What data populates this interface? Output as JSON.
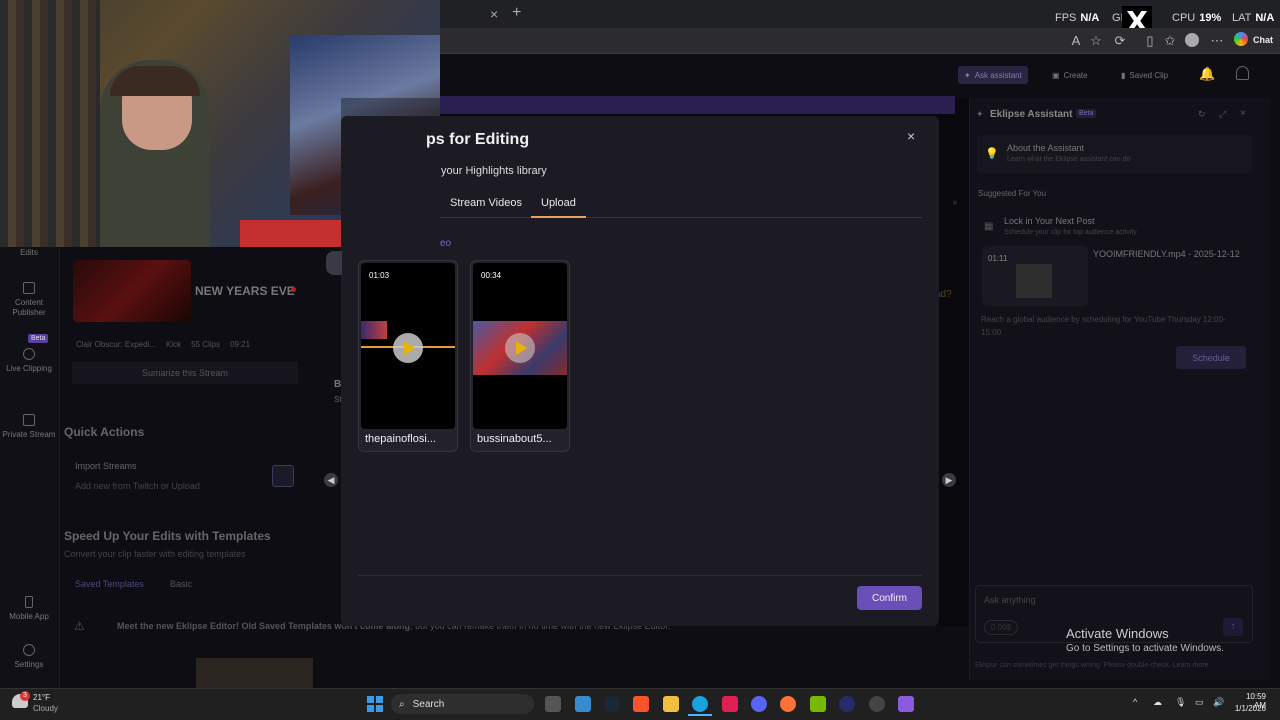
{
  "browser": {
    "new_tab": "+",
    "close_tab": "×",
    "fps_label": "FPS",
    "fps_value": "N/A",
    "gpu_label": "GI",
    "cpu_label": "CPU",
    "cpu_value": "19%",
    "lat_label": "LAT",
    "lat_value": "N/A",
    "chat_label": "Chat"
  },
  "app_header": {
    "ask_assistant": "Ask assistant",
    "create": "Create",
    "saved_clip": "Saved Clip"
  },
  "sidebar": {
    "items": [
      {
        "label": "Edits"
      },
      {
        "label": "Content Publisher"
      },
      {
        "label": "Live Clipping",
        "badge": "Beta"
      },
      {
        "label": "Private Stream"
      },
      {
        "label": "Mobile App"
      },
      {
        "label": "Settings"
      }
    ]
  },
  "main": {
    "stream_title": "NEW YEARS EVE",
    "stream_game": "Clair Obscur: Expedi...",
    "platform": "Kick",
    "clip_count": "55 Clips",
    "time": "09:21",
    "summarize": "Sumarize this Stream",
    "quick_actions": "Quick Actions",
    "import_streams": "Import Streams",
    "import_sub": "Add new from Twitch or Upload",
    "templates_title": "Speed Up Your Edits with Templates",
    "templates_sub": "Convert your clip faster with editing templates",
    "tab_saved": "Saved Templates",
    "tab_basic": "Basic",
    "notice_bold": "Meet the new Eklipse Editor!",
    "notice_bold2": "Old Saved Templates won't come along",
    "notice_rest": ", but you can remake them in no time with the new Eklipse Editor.",
    "partial_d": "ad?",
    "partial_b": "B",
    "partial_st": "St"
  },
  "modal": {
    "title": "ps for Editing",
    "subtitle": "your Highlights library",
    "tabs": [
      "Stream Videos",
      "Upload"
    ],
    "active_tab": "Upload",
    "partial_link": "eo",
    "close": "×",
    "confirm": "Confirm",
    "clips": [
      {
        "duration": "01:03",
        "name": "thepainoflosi..."
      },
      {
        "duration": "00:34",
        "name": "bussinabout5..."
      }
    ]
  },
  "assistant": {
    "title": "Eklipse Assistant",
    "badge": "Beta",
    "about_title": "About the Assistant",
    "about_sub": "Learn what the Eklipse assistant can do",
    "suggested": "Suggested For You",
    "card_title": "Lock in Your Next Post",
    "card_sub": "Schedule your clip for top audience activity",
    "clip_duration": "01:11",
    "clip_name": "YOOIMFRIENDLY.mp4 - 2025-12-12",
    "reach_text": "Reach a global audience by scheduling for YouTube Thursday 12:00-15:00",
    "schedule": "Schedule",
    "ask_placeholder": "Ask anything",
    "credits": "0.00$",
    "footer": "Eklipse can sometimes get things wrong. Please double-check.",
    "footer_link": "Learn more"
  },
  "windows": {
    "activate_title": "Activate Windows",
    "activate_sub": "Go to Settings to activate Windows.",
    "weather_temp": "21°F",
    "weather_desc": "Cloudy",
    "weather_badge": "3",
    "search": "Search",
    "time": "10:59 AM",
    "date": "1/1/2026"
  }
}
